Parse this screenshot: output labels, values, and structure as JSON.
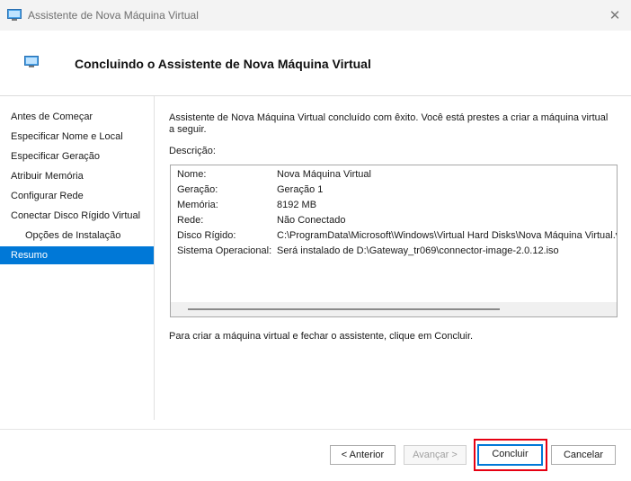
{
  "window": {
    "title": "Assistente de Nova Máquina Virtual",
    "icon": "virtual-machine-icon",
    "close_glyph": "✕"
  },
  "header": {
    "title": "Concluindo o Assistente de Nova Máquina Virtual"
  },
  "sidebar": {
    "items": [
      {
        "label": "Antes de Começar"
      },
      {
        "label": "Especificar Nome e Local"
      },
      {
        "label": "Especificar Geração"
      },
      {
        "label": "Atribuir Memória"
      },
      {
        "label": "Configurar Rede"
      },
      {
        "label": "Conectar Disco Rígido Virtual"
      },
      {
        "label": "Opções de Instalação"
      },
      {
        "label": "Resumo",
        "selected": true
      }
    ]
  },
  "main": {
    "intro": "Assistente de Nova Máquina Virtual concluído com êxito. Você está prestes a criar a máquina virtual a seguir.",
    "description_label": "Descrição:",
    "rows": [
      {
        "key": "Nome:",
        "value": "Nova Máquina Virtual"
      },
      {
        "key": "Geração:",
        "value": "Geração 1"
      },
      {
        "key": "Memória:",
        "value": "8192 MB"
      },
      {
        "key": "Rede:",
        "value": "Não Conectado"
      },
      {
        "key": "Disco Rígido:",
        "value": "C:\\ProgramData\\Microsoft\\Windows\\Virtual Hard Disks\\Nova Máquina Virtual.vl"
      },
      {
        "key": "Sistema Operacional:",
        "value": "Será instalado de D:\\Gateway_tr069\\connector-image-2.0.12.iso"
      }
    ],
    "finish_note": "Para criar a máquina virtual e fechar o assistente, clique em Concluir."
  },
  "footer": {
    "previous_label": "< Anterior",
    "next_label": "Avançar >",
    "finish_label": "Concluir",
    "cancel_label": "Cancelar"
  },
  "colors": {
    "selection": "#0078d7",
    "highlight": "#e60012"
  }
}
